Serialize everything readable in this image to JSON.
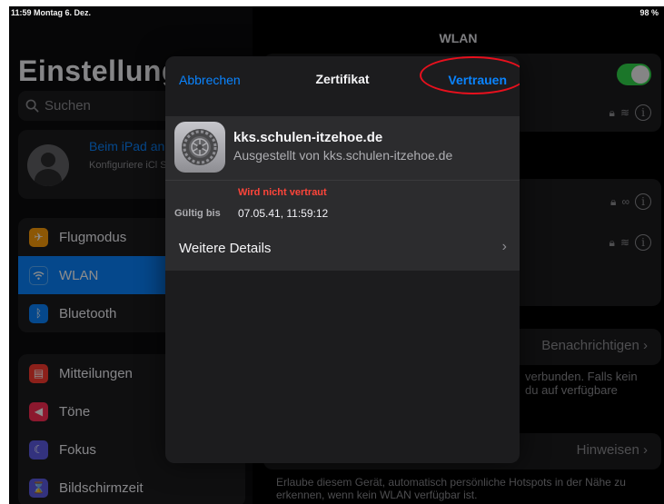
{
  "status_bar": {
    "time": "11:59",
    "date": "Montag 6. Dez.",
    "battery": "98 %"
  },
  "sidebar": {
    "title": "Einstellung",
    "search_placeholder": "Suchen",
    "profile": {
      "title": "Beim iPad an",
      "subtitle": "Konfiguriere iCl Store etc."
    },
    "group1": [
      {
        "label": "Flugmodus",
        "icon": "airplane-icon",
        "color": "#ff9f0a",
        "glyph": "✈"
      },
      {
        "label": "WLAN",
        "icon": "wifi-icon",
        "color": "#0a84ff",
        "glyph": "≋"
      },
      {
        "label": "Bluetooth",
        "icon": "bluetooth-icon",
        "color": "#0a84ff",
        "glyph": "ᛒ"
      }
    ],
    "group2": [
      {
        "label": "Mitteilungen",
        "icon": "notifications-icon",
        "color": "#ff3b30",
        "glyph": "▤"
      },
      {
        "label": "Töne",
        "icon": "speaker-icon",
        "color": "#ff2d55",
        "glyph": "◀"
      },
      {
        "label": "Fokus",
        "icon": "moon-icon",
        "color": "#5e5ce6",
        "glyph": "☾"
      },
      {
        "label": "Bildschirmzeit",
        "icon": "hourglass-icon",
        "color": "#5e5ce6",
        "glyph": "⌛"
      }
    ]
  },
  "right_pane": {
    "title": "WLAN",
    "notify_label": "Benachrichtigen",
    "notify_text": "verbunden. Falls kein du auf verfügbare",
    "hints_label": "Hinweisen",
    "footer_text": "Erlaube diesem Gerät, automatisch persönliche Hotspots in der Nähe zu erkennen, wenn kein WLAN verfügbar ist."
  },
  "modal": {
    "cancel_label": "Abbrechen",
    "title": "Zertifikat",
    "trust_label": "Vertrauen",
    "cert_name": "kks.schulen-itzehoe.de",
    "issuer": "Ausgestellt von kks.schulen-itzehoe.de",
    "warning": "Wird nicht vertraut",
    "valid_label": "Gültig bis",
    "valid_value": "07.05.41, 11:59:12",
    "details_label": "Weitere Details"
  },
  "colors": {
    "accent": "#0a84ff",
    "warning": "#ff453a",
    "highlight_ring": "#e8101d",
    "toggle_on": "#32d74b"
  }
}
